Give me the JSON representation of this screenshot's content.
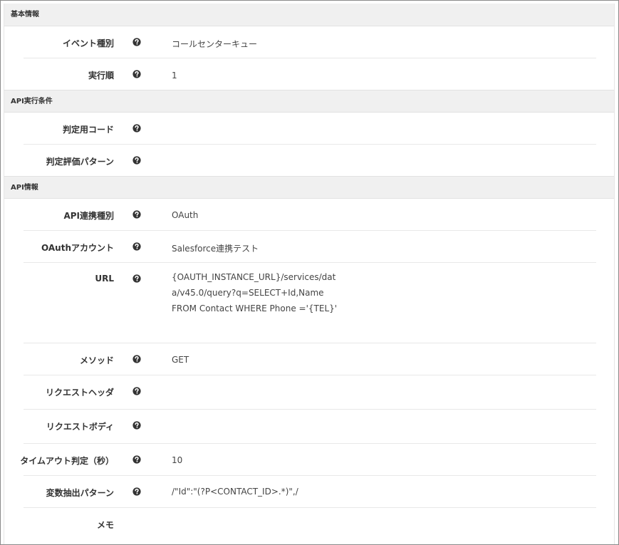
{
  "sections": {
    "basic": {
      "title": "基本情報",
      "event_type": {
        "label": "イベント種別",
        "value": "コールセンターキュー"
      },
      "exec_order": {
        "label": "実行順",
        "value": "1"
      }
    },
    "api_condition": {
      "title": "API実行条件",
      "judge_code": {
        "label": "判定用コード",
        "value": ""
      },
      "judge_pattern": {
        "label": "判定評価パターン",
        "value": ""
      }
    },
    "api_info": {
      "title": "API情報",
      "api_type": {
        "label": "API連携種別",
        "value": "OAuth"
      },
      "oauth_account": {
        "label": "OAuthアカウント",
        "value": "Salesforce連携テスト"
      },
      "url": {
        "label": "URL",
        "lines": [
          "{OAUTH_INSTANCE_URL}/services/dat",
          "a/v45.0/query?q=SELECT+Id,Name",
          "FROM Contact WHERE Phone ='{TEL}'"
        ]
      },
      "method": {
        "label": "メソッド",
        "value": "GET"
      },
      "request_header": {
        "label": "リクエストヘッダ",
        "value": ""
      },
      "request_body": {
        "label": "リクエストボディ",
        "value": ""
      },
      "timeout": {
        "label": "タイムアウト判定（秒）",
        "value": "10"
      },
      "var_pattern": {
        "label": "変数抽出パターン",
        "value": "/\"Id\":\"(?P<CONTACT_ID>.*)\",/"
      },
      "memo": {
        "label": "メモ",
        "value": ""
      }
    }
  },
  "icons": {
    "help": "question-circle-icon"
  },
  "colors": {
    "header_bg": "#f0f0f0",
    "divider": "#e8e8e8",
    "icon": "#333333"
  }
}
